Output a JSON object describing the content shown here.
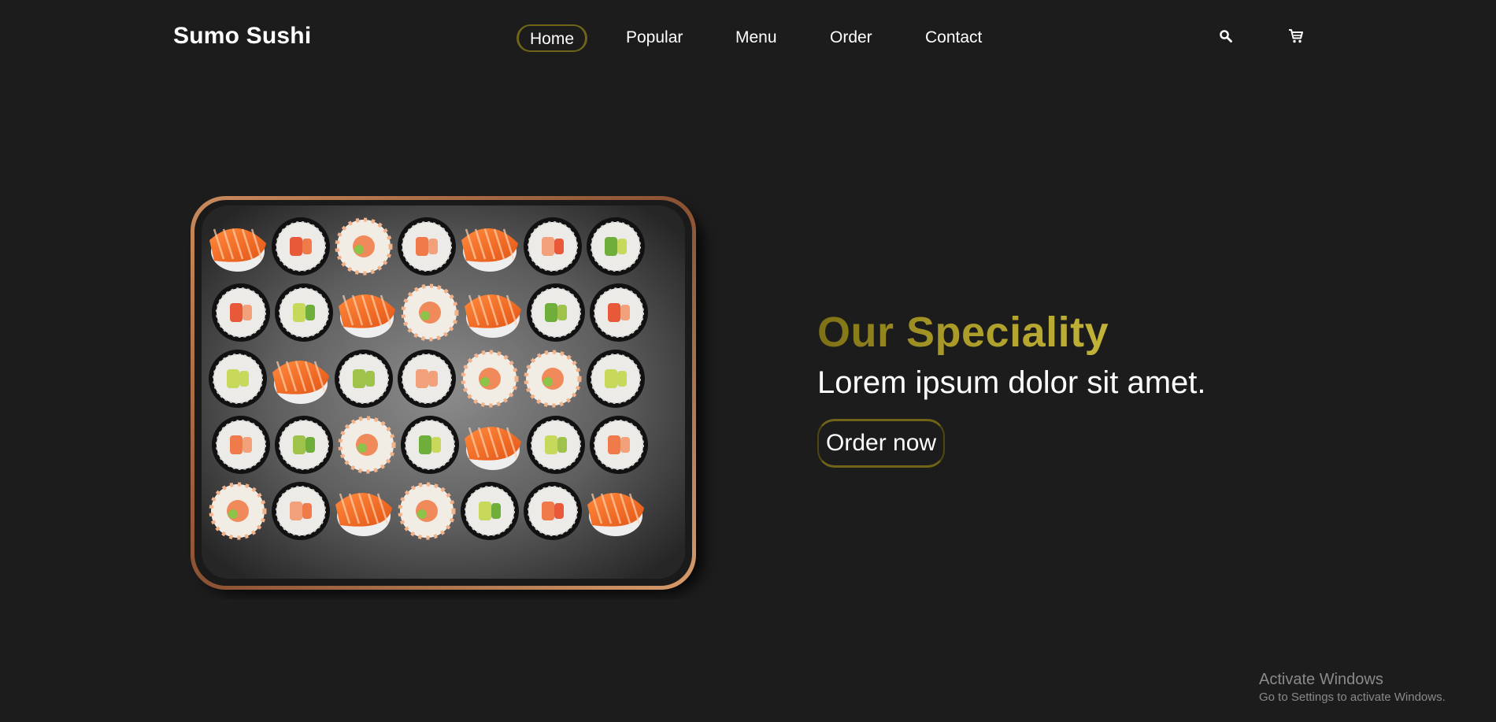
{
  "header": {
    "logo": "Sumo Sushi",
    "nav": [
      {
        "label": "Home",
        "active": true
      },
      {
        "label": "Popular",
        "active": false
      },
      {
        "label": "Menu",
        "active": false
      },
      {
        "label": "Order",
        "active": false
      },
      {
        "label": "Contact",
        "active": false
      }
    ],
    "icons": {
      "search": "search-icon",
      "cart": "cart-icon"
    }
  },
  "hero": {
    "heading": "Our Speciality",
    "subheading": "Lorem ipsum dolor sit amet.",
    "cta_label": "Order now",
    "image": "sushi-platter"
  },
  "watermark": {
    "title": "Activate Windows",
    "subtitle": "Go to Settings to activate Windows."
  },
  "colors": {
    "background": "#1c1c1c",
    "accent_gold": "#a99a28",
    "accent_gold_dark": "#6f6418",
    "text": "#ffffff"
  }
}
